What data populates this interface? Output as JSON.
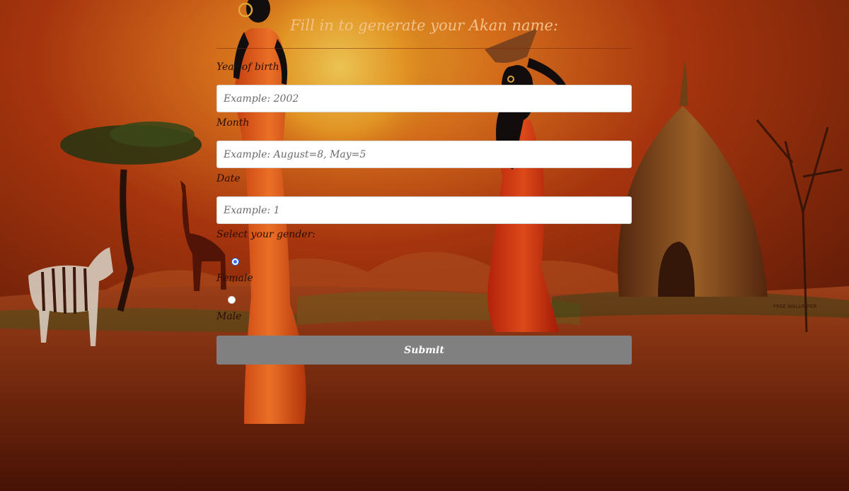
{
  "form": {
    "heading": "Fill in to generate your Akan name:",
    "year_label": "Year of birth",
    "year_placeholder": "Example: 2002",
    "month_label": "Month",
    "month_placeholder": "Example: August=8, May=5",
    "date_label": "Date",
    "date_placeholder": "Example: 1",
    "gender_label": "Select your gender:",
    "gender_options": [
      {
        "label": "Female",
        "selected": true
      },
      {
        "label": "Male",
        "selected": false
      }
    ],
    "submit_label": "Submit"
  },
  "colors": {
    "submit_background": "#808080",
    "heading_text": "#f3c28a",
    "radio_accent": "#2f6fe6"
  }
}
